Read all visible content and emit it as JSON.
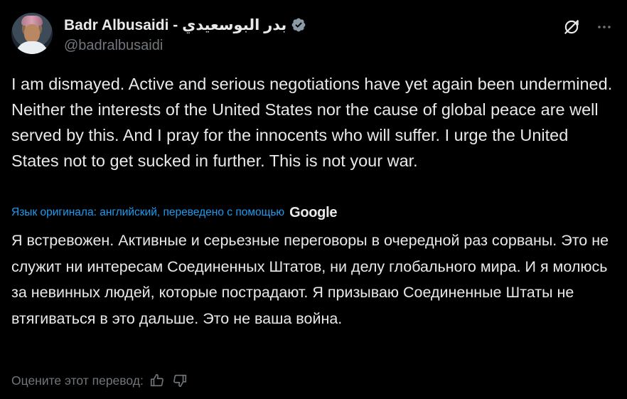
{
  "author": {
    "display_name": "Badr Albusaidi - بدر البوسعيدي",
    "handle": "@badralbusaidi",
    "verified": true,
    "avatar_icon": "profile-photo"
  },
  "tweet": {
    "text": "I am dismayed. Active and serious negotiations have yet again been undermined. Neither the interests of the United States nor the cause of global peace are well served by this. And I pray for the innocents who will suffer. I urge the United States not to get sucked in further. This is not your war."
  },
  "translation": {
    "source_note": "Язык оригинала: английский, переведено с помощью",
    "provider": "Google",
    "text": "Я встревожен. Активные и серьезные переговоры в очередной раз сорваны. Это не служит ни интересам Соединенных Штатов, ни делу глобального мира. И я молюсь за невинных людей, которые пострадают. Я призываю Соединенные Штаты не втягиваться в это дальше. Это не ваша война.",
    "rate_label": "Оцените этот перевод:"
  },
  "icons": {
    "verified": "verified-badge-icon",
    "grok": "grok-icon",
    "more": "more-icon",
    "thumbs_up": "thumbs-up-icon",
    "thumbs_down": "thumbs-down-icon"
  },
  "colors": {
    "background": "#000000",
    "text_primary": "#e7e9ea",
    "text_secondary": "#71767b",
    "link": "#1d9bf0",
    "verified_badge": "#8b98a5"
  }
}
